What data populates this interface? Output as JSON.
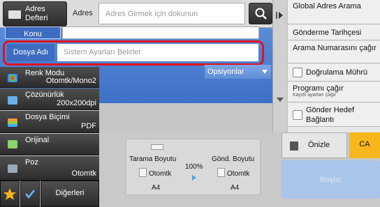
{
  "top": {
    "address_book_label": "Adres Defteri",
    "address_label": "Adres",
    "address_placeholder": "Adres Girmek için dokunun"
  },
  "fields": {
    "subject_label": "Konu",
    "filename_label": "Dosya Adı",
    "filename_placeholder": "Sistem Ayarları Belirler",
    "options_label": "Opsiyonlar"
  },
  "settings": [
    {
      "label": "Renk Modu",
      "value": "Otomtk/Mono2"
    },
    {
      "label": "Çözünürlük",
      "value": "200x200dpi"
    },
    {
      "label": "Dosya Biçimi",
      "value": "PDF"
    },
    {
      "label": "Orijinal",
      "value": ""
    },
    {
      "label": "Poz",
      "value": "Otomtk"
    }
  ],
  "bottom_bar": {
    "others_label": "Diğerleri"
  },
  "scan": {
    "scan_size_label": "Tarama Boyutu",
    "send_size_label": "Gönd. Boyutu",
    "ratio": "100%",
    "scan_mode": "Otomtk",
    "scan_paper": "A4",
    "send_mode": "Otomtk",
    "send_paper": "A4"
  },
  "right_panel": {
    "global_search": "Global Adres Arama",
    "send_history": "Gönderme Tarihçesi",
    "call_search_number": "Arama Numarasını çağır",
    "verify_stamp": "Doğrulama Mührü",
    "program_call": "Programı çağır",
    "program_sub": "Kayıtlı ayarları çağır",
    "send_link": "Gönder Hedef Bağlantı"
  },
  "actions": {
    "preview": "Önizle",
    "ca": "CA",
    "start": "Başlat"
  }
}
